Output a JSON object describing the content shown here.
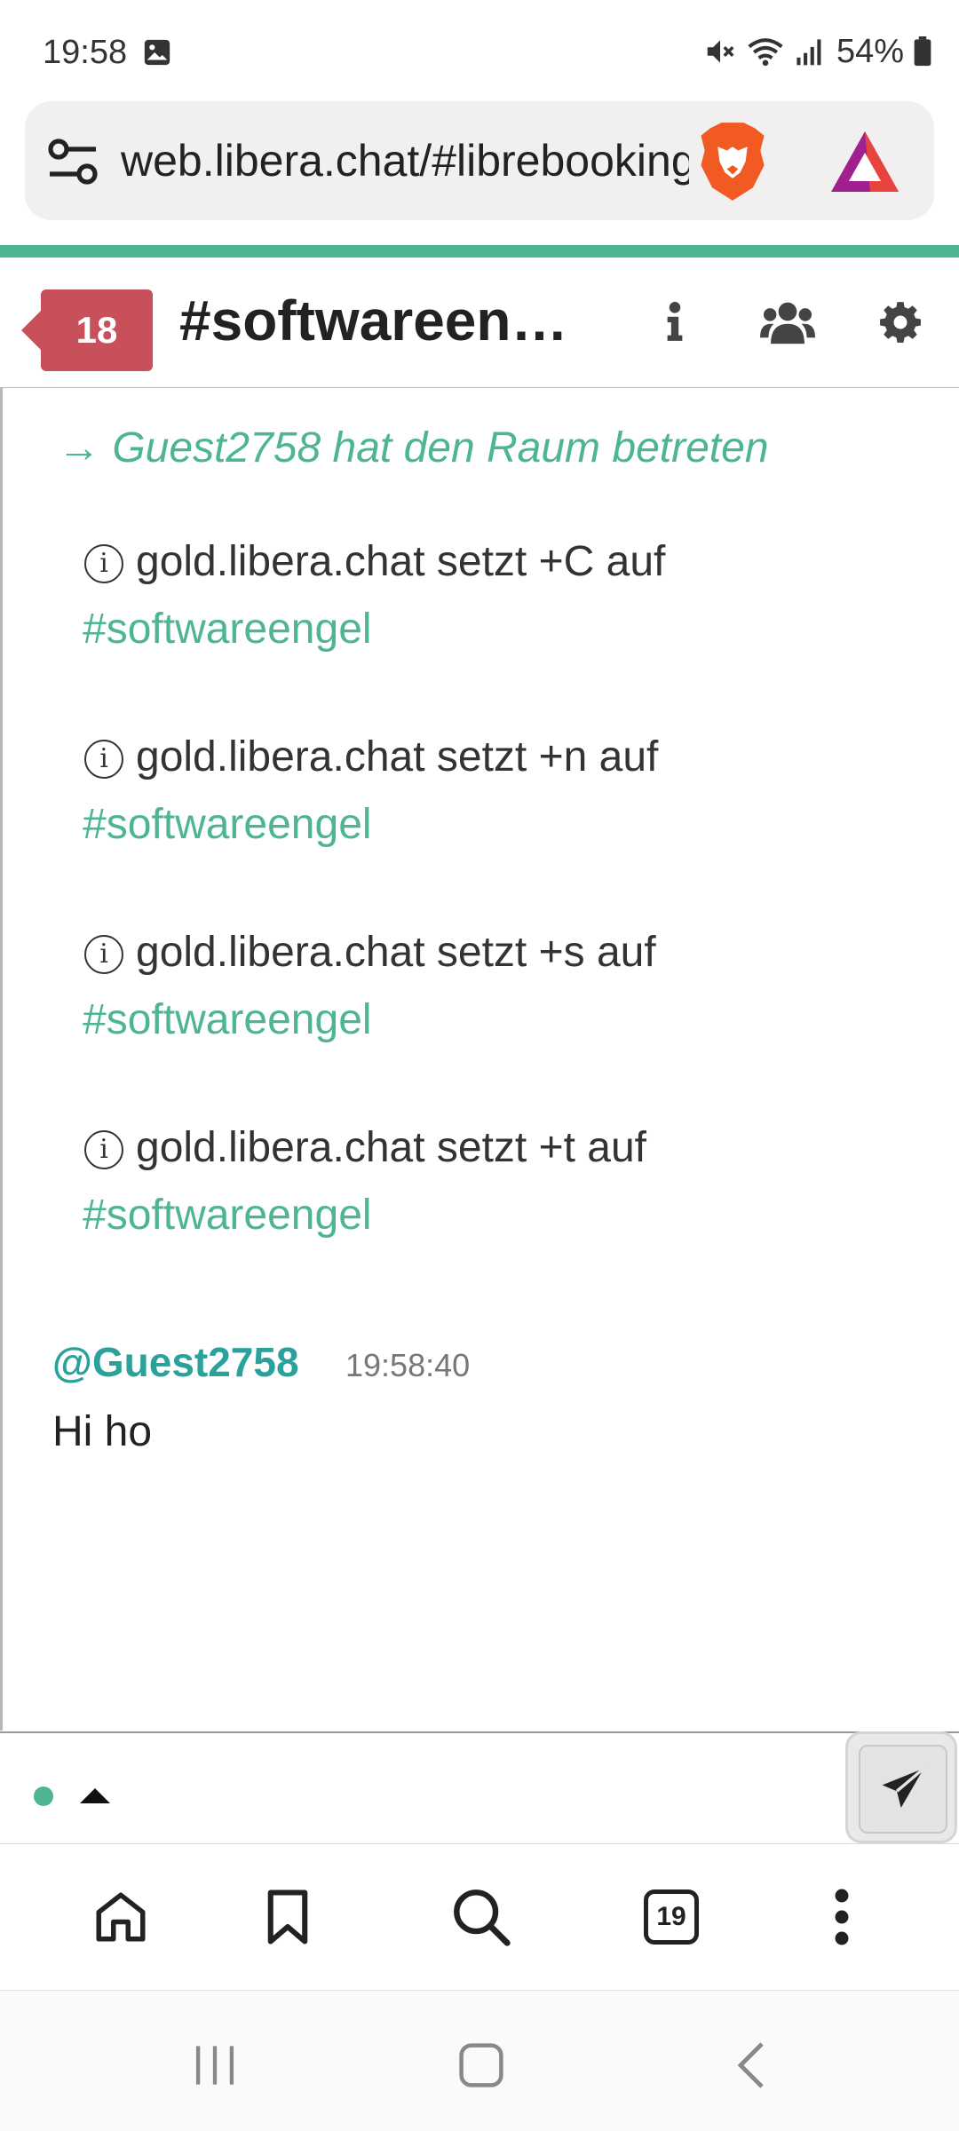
{
  "status_bar": {
    "time": "19:58",
    "battery_text": "54%",
    "icons": [
      "image-icon",
      "mute-icon",
      "wifi-icon",
      "signal-icon",
      "battery-icon"
    ]
  },
  "browser": {
    "url": "web.libera.chat/#librebooking",
    "tab_count": "19"
  },
  "channel": {
    "unread_badge": "18",
    "title": "#softwareen…"
  },
  "messages": {
    "join_text": "→ Guest2758 hat den Raum betreten",
    "system": [
      {
        "text": "gold.libera.chat setzt +C auf",
        "channel": "#softwareengel"
      },
      {
        "text": "gold.libera.chat setzt +n auf",
        "channel": "#softwareengel"
      },
      {
        "text": "gold.libera.chat setzt +s auf",
        "channel": "#softwareengel"
      },
      {
        "text": "gold.libera.chat setzt +t auf",
        "channel": "#softwareengel"
      }
    ],
    "chat": {
      "nick": "@Guest2758",
      "time": "19:58:40",
      "text": "Hi ho"
    }
  },
  "colors": {
    "accent": "#4db494",
    "badge": "#c8505a",
    "nick": "#2aa19a"
  }
}
